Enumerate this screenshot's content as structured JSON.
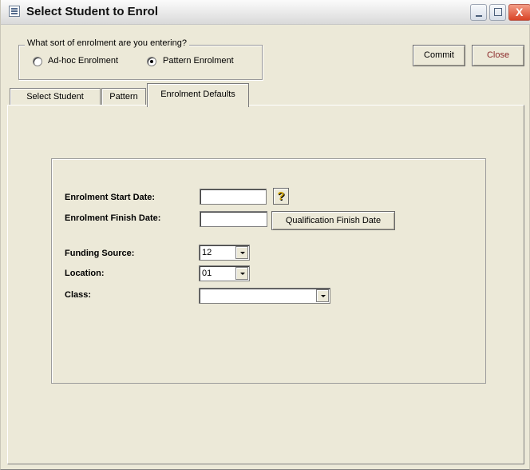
{
  "window": {
    "title": "Select Student to Enrol",
    "icon": "form-icon",
    "controls": [
      "minimize-icon",
      "maximize-icon",
      "close-icon"
    ],
    "close_glyph": "X"
  },
  "enrolment_type": {
    "question": "What sort of enrolment are you entering?",
    "options": [
      {
        "label": "Ad-hoc Enrolment",
        "selected": false
      },
      {
        "label": "Pattern Enrolment",
        "selected": true
      }
    ]
  },
  "actions": {
    "commit_label": "Commit",
    "close_label": "Close",
    "close_color": "#8b2a2a"
  },
  "tabs": [
    {
      "label": "Select Student",
      "active": false
    },
    {
      "label": "Pattern",
      "active": false
    },
    {
      "label": "Enrolment Defaults",
      "active": true
    }
  ],
  "form": {
    "start_date_label": "Enrolment Start Date:",
    "start_date_value": "",
    "help_glyph": "?",
    "finish_date_label": "Enrolment Finish Date:",
    "finish_date_value": "",
    "qualification_button": "Qualification Finish Date",
    "funding_source_label": "Funding Source:",
    "funding_source_value": "12",
    "location_label": "Location:",
    "location_value": "01",
    "class_label": "Class:",
    "class_value": ""
  }
}
